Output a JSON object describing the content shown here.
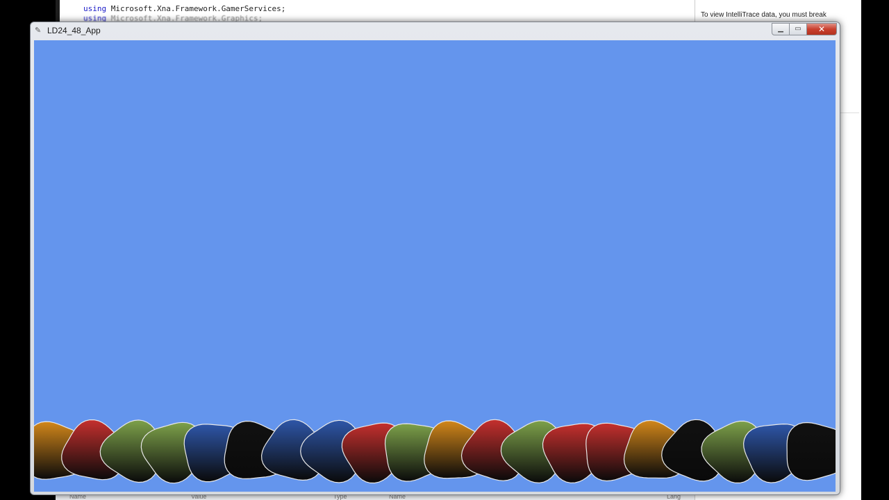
{
  "ide": {
    "code_line_1_keyword": "using",
    "code_line_1_rest": " Microsoft.Xna.Framework.GamerServices;",
    "code_line_2_keyword": "using",
    "code_line_2_rest": " Microsoft.Xna.Framework.Graphics;",
    "intellitrace_text": "To view IntelliTrace data, you must break",
    "bottom_col_name": "Name",
    "bottom_col_value": "Value",
    "bottom_col_type": "Type",
    "bottom_col_name2": "Name",
    "bottom_col_lang": "Lang"
  },
  "window": {
    "title": "LD24_48_App",
    "minimize_icon": "minimize-icon",
    "maximize_icon": "maximize-icon",
    "close_icon": "close-icon",
    "close_glyph": "✕"
  },
  "game": {
    "background_color": "#6495ED",
    "ground_blobs": [
      {
        "color": "#d2871a"
      },
      {
        "color": "#c5302e"
      },
      {
        "color": "#7da14a"
      },
      {
        "color": "#7da14a"
      },
      {
        "color": "#2e56a8"
      },
      {
        "color": "#111111"
      },
      {
        "color": "#2e56a8"
      },
      {
        "color": "#2e56a8"
      },
      {
        "color": "#c5302e"
      },
      {
        "color": "#7da14a"
      },
      {
        "color": "#d2871a"
      },
      {
        "color": "#c5302e"
      },
      {
        "color": "#7da14a"
      },
      {
        "color": "#c5302e"
      },
      {
        "color": "#c5302e"
      },
      {
        "color": "#d2871a"
      },
      {
        "color": "#111111"
      },
      {
        "color": "#7da14a"
      },
      {
        "color": "#2e56a8"
      },
      {
        "color": "#111111"
      }
    ]
  }
}
